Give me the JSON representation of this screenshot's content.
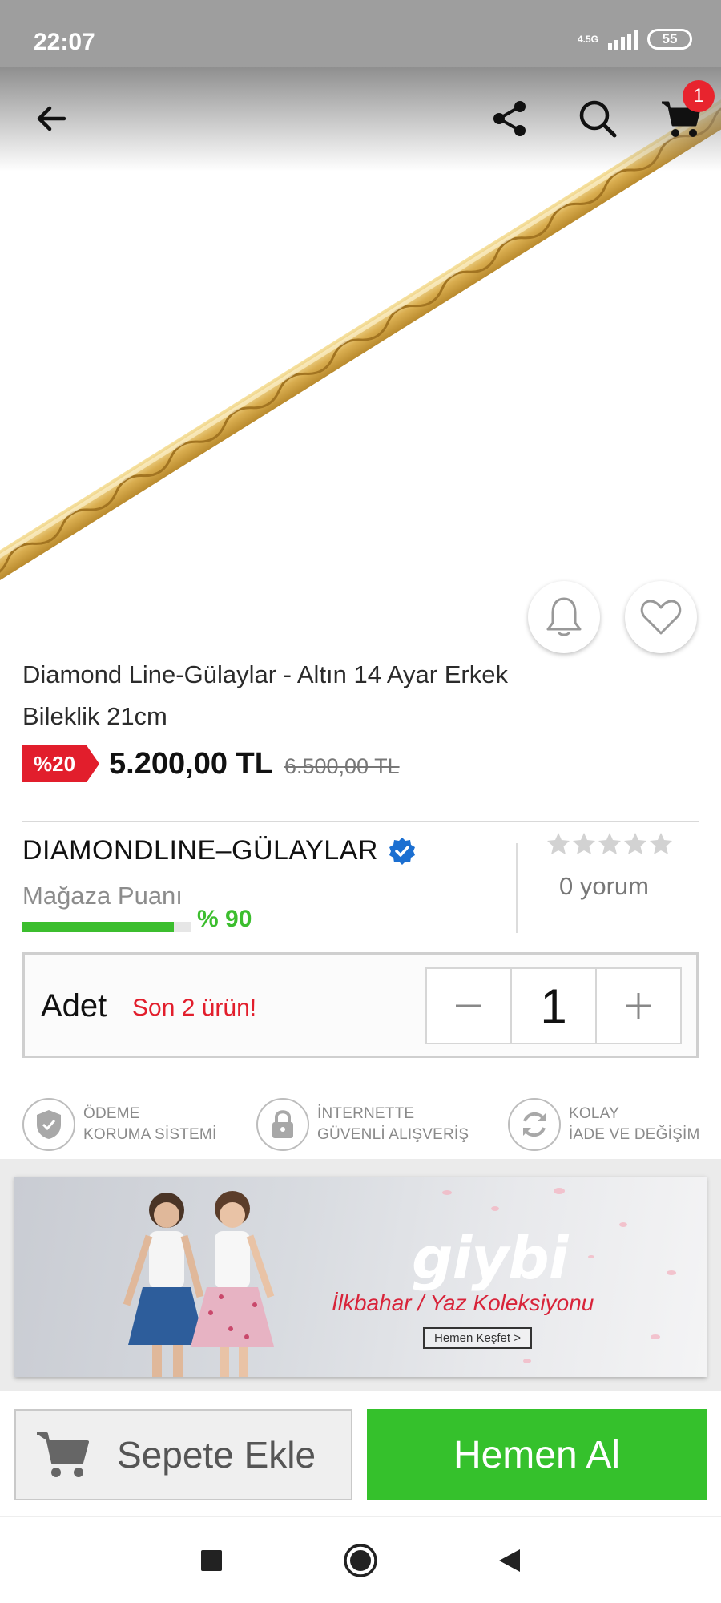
{
  "status_bar": {
    "time": "22:07",
    "network": "4.5G",
    "battery": "55"
  },
  "top_bar": {
    "back_icon": "arrow-left-icon",
    "share_icon": "share-icon",
    "search_icon": "search-icon",
    "cart_icon": "cart-icon",
    "cart_count": "1"
  },
  "product": {
    "title": "Diamond Line-Gülaylar - Altın 14 Ayar Erkek Bileklik 21cm",
    "discount": "%20",
    "price": "5.200,00 TL",
    "old_price": "6.500,00 TL"
  },
  "store": {
    "name": "DIAMONDLINE–GÜLAYLAR",
    "score_label": "Mağaza Puanı",
    "score_percent": "% 90",
    "score_value": 0.9,
    "rating_stars": 0,
    "review_count": "0 yorum"
  },
  "quantity": {
    "label": "Adet",
    "stock_note": "Son 2 ürün!",
    "value": "1"
  },
  "guarantees": [
    {
      "icon": "shield-check-icon",
      "line1": "ÖDEME",
      "line2": "KORUMA SİSTEMİ"
    },
    {
      "icon": "lock-icon",
      "line1": "İNTERNETTE",
      "line2": "GÜVENLİ ALIŞVERİŞ"
    },
    {
      "icon": "refresh-icon",
      "line1": "KOLAY",
      "line2": "İADE VE DEĞİŞİM"
    }
  ],
  "banner": {
    "brand": "giybi",
    "subtitle": "İlkbahar / Yaz Koleksiyonu",
    "cta": "Hemen Keşfet >"
  },
  "actions": {
    "add_to_cart": "Sepete Ekle",
    "buy_now": "Hemen Al"
  },
  "colors": {
    "accent_green": "#35c12c",
    "discount_red": "#e21e2c",
    "verified_blue": "#1b6fd1"
  }
}
